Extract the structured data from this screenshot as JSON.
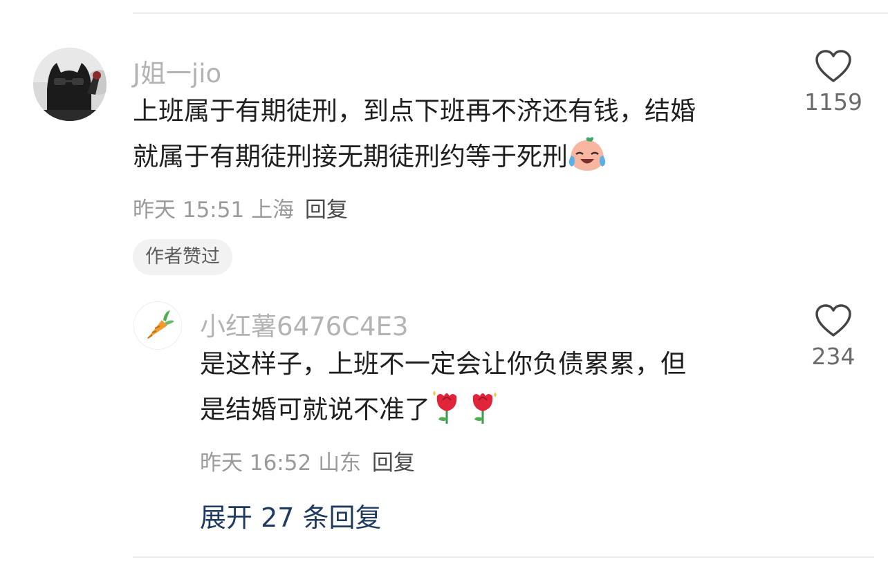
{
  "comments": [
    {
      "username": "J姐一jio",
      "text_line1": "上班属于有期徒刑，到点下班再不济还有钱，结婚",
      "text_line2": "就属于有期徒刑接无期徒刑约等于死刑",
      "emoji": "crying-laughing-peach-emoji",
      "time": "昨天 15:51",
      "location": "上海",
      "reply_label": "回复",
      "badge": "作者赞过",
      "likes": "1159",
      "avatar": "black-cat-with-sunglasses-avatar"
    },
    {
      "username": "小红薯6476C4E3",
      "text_line1": "是这样子，上班不一定会让你负债累累，但",
      "text_line2": "是结婚可就说不准了",
      "emoji": "rose-emoji",
      "time": "昨天 16:52",
      "location": "山东",
      "reply_label": "回复",
      "likes": "234",
      "avatar": "carrot-avatar"
    }
  ],
  "expand_replies": "展开 27 条回复",
  "colors": {
    "username": "#b3b3b3",
    "meta": "#9a9a9a",
    "link": "#1f3a5f",
    "badge_bg": "#f2f2f2"
  }
}
